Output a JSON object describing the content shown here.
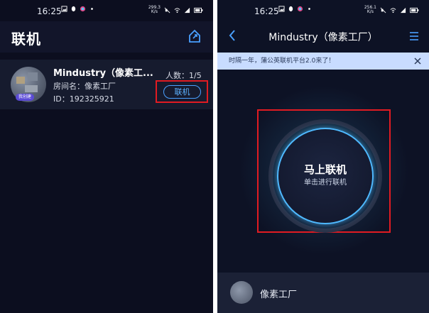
{
  "status": {
    "time": "16:25",
    "left_speed": "299.3\nK/s",
    "right_speed": "256.1\nK/s"
  },
  "left": {
    "title": "联机",
    "room": {
      "name": "Mindustry（像素工...",
      "room_name_line": "房间名：像素工厂",
      "id_line": "ID：192325921",
      "players": "人数：1/5",
      "connect_label": "联机",
      "badge": "我创建"
    }
  },
  "right": {
    "title": "Mindustry（像素工厂）",
    "banner": "时隔一年，蒲公英联机平台2.0来了！",
    "connect_title": "马上联机",
    "connect_subtitle": "单击进行联机",
    "room_name": "像素工厂"
  },
  "colors": {
    "accent_blue": "#4aa0ff",
    "highlight_red": "#e11b22",
    "banner_bg": "#c8dcff"
  }
}
